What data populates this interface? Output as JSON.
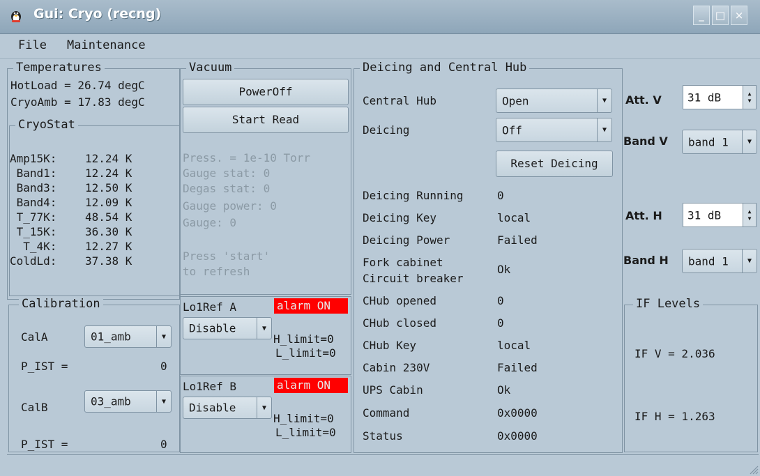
{
  "window": {
    "title": "Gui: Cryo (recng)",
    "minimize": "_",
    "maximize": "□",
    "close": "×"
  },
  "menu": [
    "File",
    "Maintenance"
  ],
  "temperatures": {
    "title": "Temperatures",
    "lines": [
      "HotLoad = 26.74 degC",
      "CryoAmb = 17.83 degC"
    ]
  },
  "cryostat": {
    "title": "CryoStat",
    "rows": [
      {
        "label": "Amp15K:",
        "value": "12.24 K"
      },
      {
        "label": " Band1:",
        "value": "12.24 K"
      },
      {
        "label": " Band3:",
        "value": "12.50 K"
      },
      {
        "label": " Band4:",
        "value": "12.09 K"
      },
      {
        "label": " T_77K:",
        "value": "48.54 K"
      },
      {
        "label": " T_15K:",
        "value": "36.30 K"
      },
      {
        "label": "  T_4K:",
        "value": "12.27 K"
      },
      {
        "label": "ColdLd:",
        "value": "37.38 K"
      }
    ]
  },
  "calibration": {
    "title": "Calibration",
    "cal_a_label": "CalA",
    "cal_a_value": "01_amb",
    "p_ist_a_label": "P_IST =",
    "p_ist_a_value": "0",
    "cal_b_label": "CalB",
    "cal_b_value": "03_amb",
    "p_ist_b_label": "P_IST =",
    "p_ist_b_value": "0"
  },
  "vacuum": {
    "title": "Vacuum",
    "power_button": "PowerOff",
    "read_button": "Start Read",
    "status_lines": [
      "Press. = 1e-10 Torr",
      "Gauge stat: 0",
      "Degas stat: 0",
      "Gauge power: 0",
      "Gauge: 0"
    ],
    "hint_lines": [
      "Press 'start'",
      "to refresh"
    ]
  },
  "lo1ref_a": {
    "label": "Lo1Ref A",
    "alarm": "alarm ON",
    "mode": "Disable",
    "h_limit": "H_limit=0",
    "l_limit": "L_limit=0"
  },
  "lo1ref_b": {
    "label": "Lo1Ref B",
    "alarm": "alarm ON",
    "mode": "Disable",
    "h_limit": "H_limit=0",
    "l_limit": "L_limit=0"
  },
  "deicing": {
    "title": "Deicing and Central Hub",
    "central_hub_label": "Central Hub",
    "central_hub_value": "Open",
    "deicing_label": "Deicing",
    "deicing_value": "Off",
    "reset_button": "Reset Deicing",
    "rows": [
      {
        "label": "Deicing Running",
        "value": "0"
      },
      {
        "label": "Deicing Key",
        "value": "local"
      },
      {
        "label": "Deicing Power",
        "value": "Failed"
      }
    ],
    "fork_label_1": "Fork cabinet",
    "fork_label_2": "Circuit breaker",
    "fork_value": "Ok",
    "rows2": [
      {
        "label": "CHub opened",
        "value": "0"
      },
      {
        "label": "CHub closed",
        "value": "0"
      },
      {
        "label": "CHub Key",
        "value": "local"
      },
      {
        "label": "Cabin 230V",
        "value": "Failed"
      },
      {
        "label": "UPS Cabin",
        "value": "Ok"
      },
      {
        "label": "Command",
        "value": "0x0000"
      },
      {
        "label": "Status",
        "value": "0x0000"
      }
    ]
  },
  "right": {
    "att_v_label": "Att. V",
    "att_v_value": "31 dB",
    "band_v_label": "Band V",
    "band_v_value": "band 1",
    "att_h_label": "Att. H",
    "att_h_value": "31 dB",
    "band_h_label": "Band H",
    "band_h_value": "band 1",
    "if_title": "IF Levels",
    "if_v": "IF V = 2.036",
    "if_h": "IF H = 1.263"
  },
  "colors": {
    "background": "#b9c9d6",
    "alarm": "#ff0000",
    "titlebar": "#9fb3c3"
  }
}
